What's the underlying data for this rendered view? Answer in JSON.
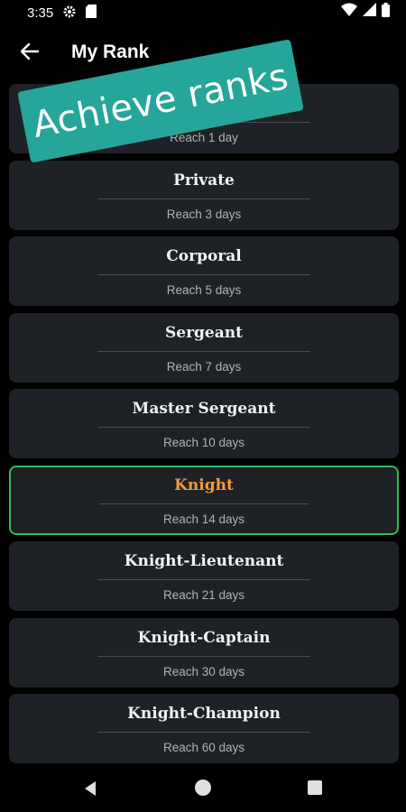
{
  "status": {
    "time": "3:35"
  },
  "appbar": {
    "title": "My Rank"
  },
  "banner": {
    "text": "Achieve ranks"
  },
  "ranks": [
    {
      "name": "",
      "requirement": "Reach 1 day"
    },
    {
      "name": "Private",
      "requirement": "Reach 3 days"
    },
    {
      "name": "Corporal",
      "requirement": "Reach 5 days"
    },
    {
      "name": "Sergeant",
      "requirement": "Reach 7 days"
    },
    {
      "name": "Master Sergeant",
      "requirement": "Reach 10 days"
    },
    {
      "name": "Knight",
      "requirement": "Reach 14 days",
      "selected": true
    },
    {
      "name": "Knight-Lieutenant",
      "requirement": "Reach 21 days"
    },
    {
      "name": "Knight-Captain",
      "requirement": "Reach 30 days"
    },
    {
      "name": "Knight-Champion",
      "requirement": "Reach 60 days"
    }
  ],
  "colors": {
    "card_bg": "#1e2126",
    "selected_border": "#2fbb5a",
    "selected_text": "#f39a3c",
    "banner_bg": "#26a69a"
  }
}
